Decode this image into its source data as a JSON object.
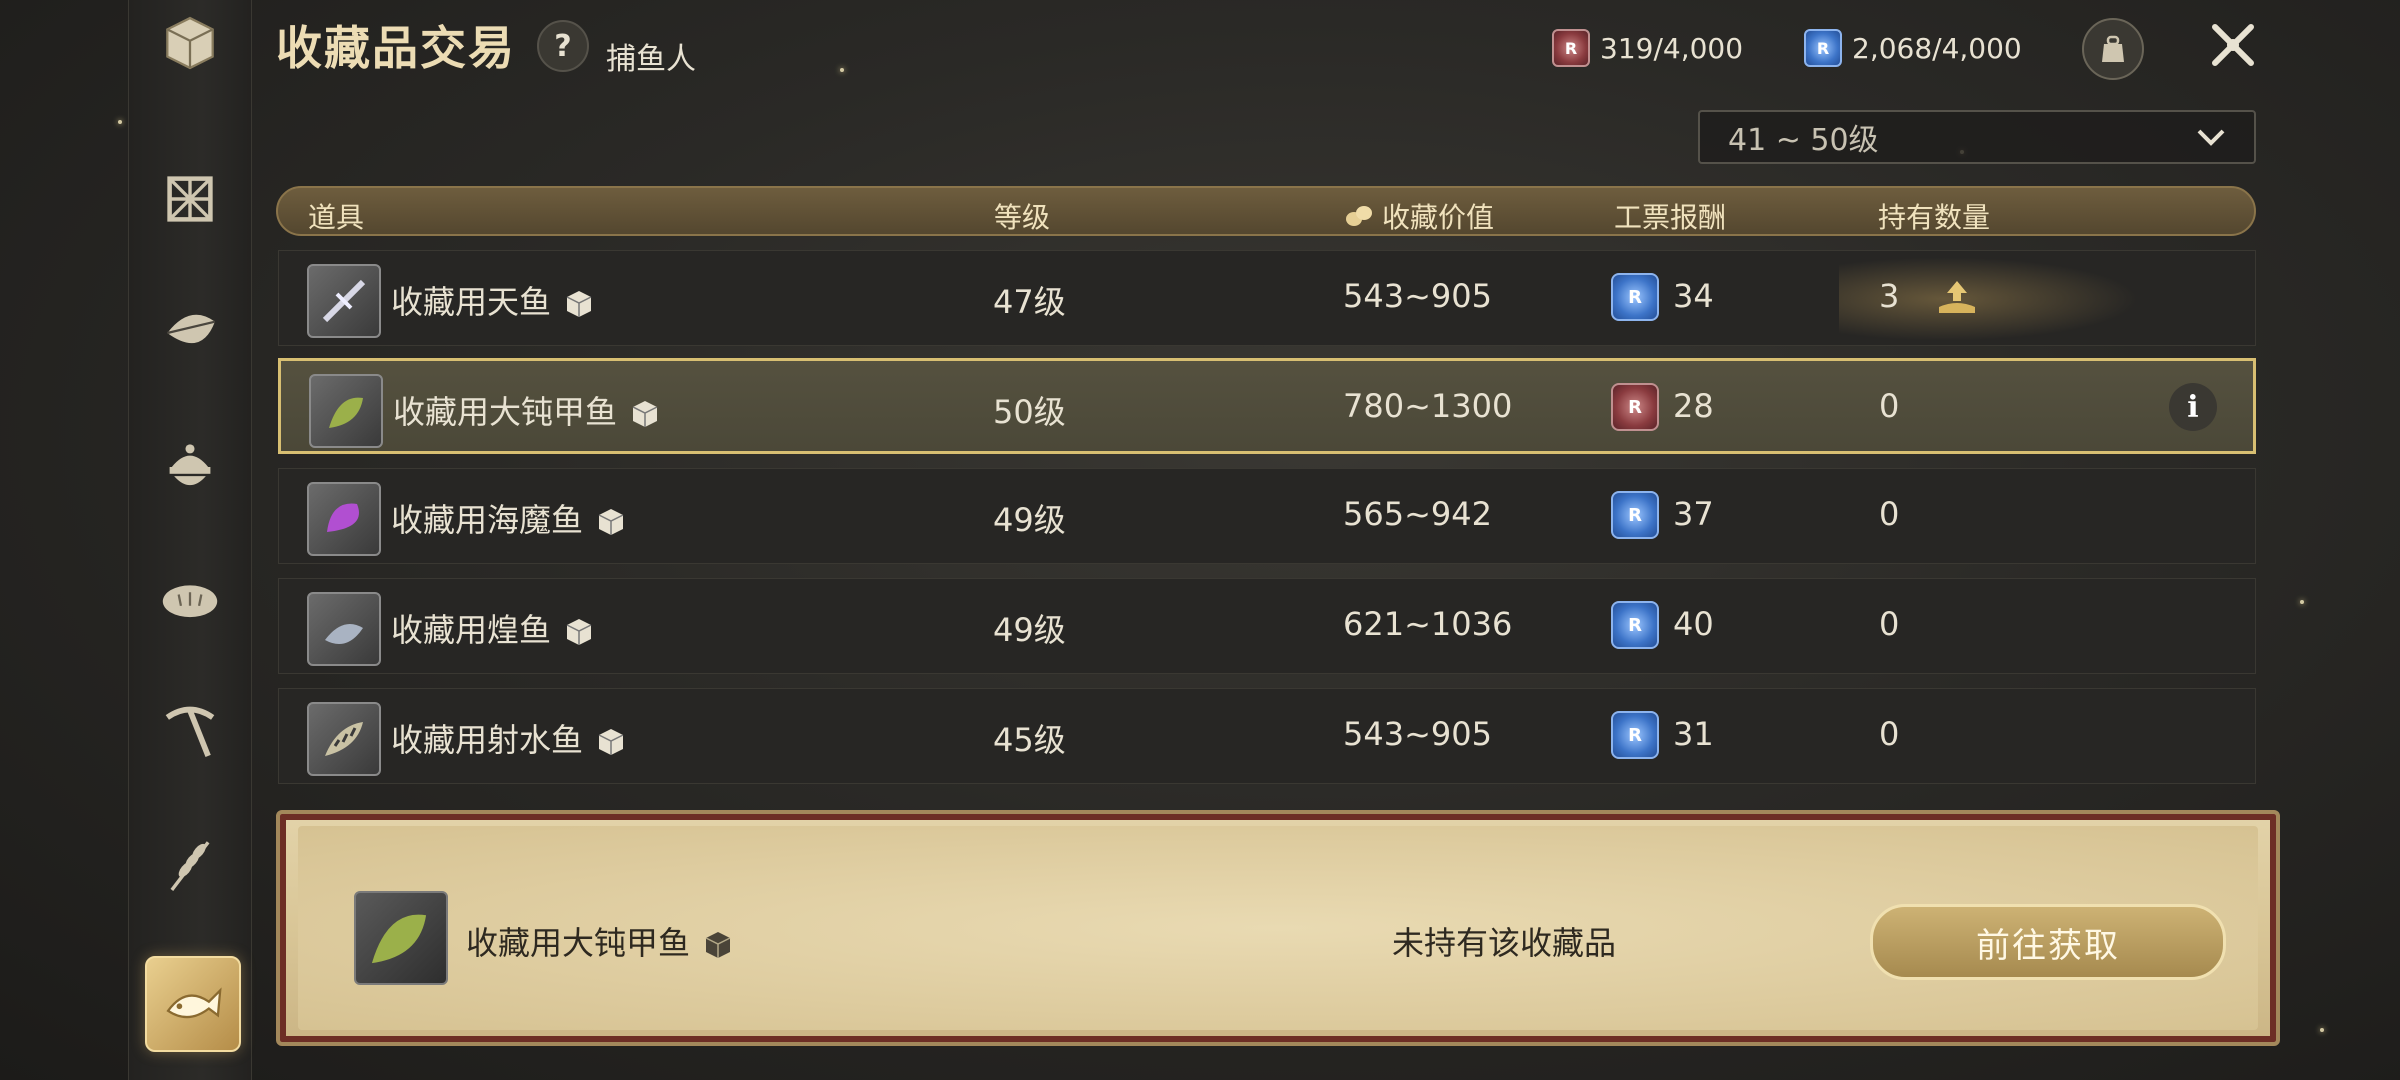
{
  "header": {
    "title": "收藏品交易",
    "help_label": "?",
    "subtitle": "捕鱼人",
    "currency_red": "319/4,000",
    "currency_blue": "2,068/4,000"
  },
  "filter": {
    "level_range": "41 ~ 50级"
  },
  "table": {
    "columns": {
      "item": "道具",
      "level": "等级",
      "value": "收藏价值",
      "reward": "工票报酬",
      "owned": "持有数量"
    },
    "rows": [
      {
        "name": "收藏用天鱼",
        "level": "47级",
        "value": "543~905",
        "reward_type": "blue",
        "reward": "34",
        "owned": "3"
      },
      {
        "name": "收藏用大钝甲鱼",
        "level": "50级",
        "value": "780~1300",
        "reward_type": "red",
        "reward": "28",
        "owned": "0"
      },
      {
        "name": "收藏用海魔鱼",
        "level": "49级",
        "value": "565~942",
        "reward_type": "blue",
        "reward": "37",
        "owned": "0"
      },
      {
        "name": "收藏用煌鱼",
        "level": "49级",
        "value": "621~1036",
        "reward_type": "blue",
        "reward": "40",
        "owned": "0"
      },
      {
        "name": "收藏用射水鱼",
        "level": "45级",
        "value": "543~905",
        "reward_type": "blue",
        "reward": "31",
        "owned": "0"
      }
    ]
  },
  "detail": {
    "item_name": "收藏用大钝甲鱼",
    "status": "未持有该收藏品",
    "goto_label": "前往获取"
  },
  "info_label": "i",
  "colors": {
    "accent_gold": "#d8bf72",
    "currency_red": "#8a3b3f",
    "currency_blue": "#3d74c8"
  }
}
